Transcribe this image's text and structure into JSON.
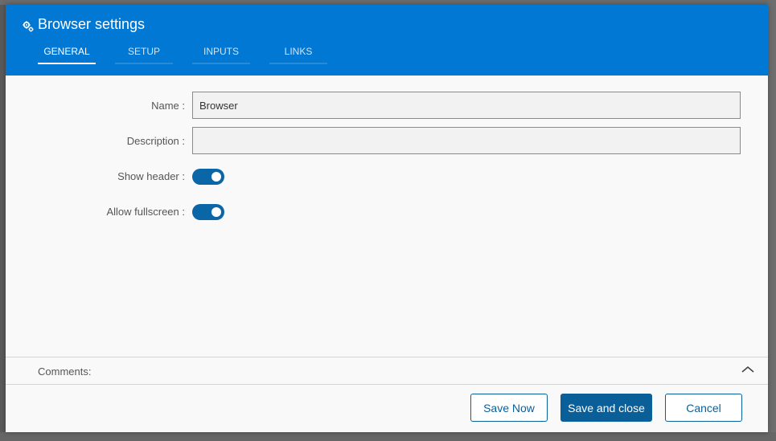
{
  "dialog": {
    "title": "Browser settings",
    "icon": "gear-icon"
  },
  "tabs": [
    {
      "label": "GENERAL",
      "active": true
    },
    {
      "label": "SETUP",
      "active": false
    },
    {
      "label": "INPUTS",
      "active": false
    },
    {
      "label": "LINKS",
      "active": false
    }
  ],
  "form": {
    "name_label": "Name :",
    "name_value": "Browser",
    "description_label": "Description :",
    "description_value": "",
    "show_header_label": "Show header :",
    "show_header_on": true,
    "allow_fullscreen_label": "Allow fullscreen :",
    "allow_fullscreen_on": true
  },
  "comments": {
    "label": "Comments:"
  },
  "footer": {
    "save_now_label": "Save Now",
    "save_close_label": "Save and close",
    "cancel_label": "Cancel"
  },
  "colors": {
    "header": "#0078d4",
    "accent": "#0a5f99",
    "toggle": "#0a66a6"
  }
}
